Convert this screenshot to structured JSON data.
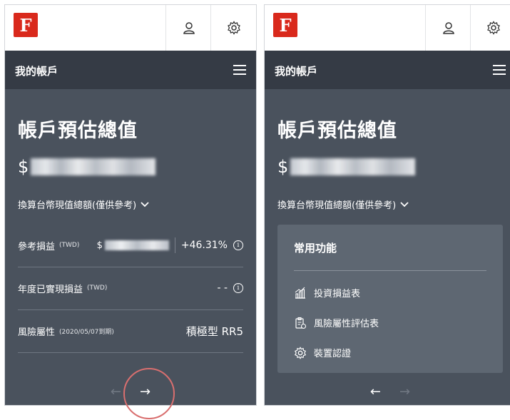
{
  "logo_letter": "F",
  "icons": [
    "user-icon",
    "gear-icon",
    "hamburger-icon",
    "info-icon",
    "chevron-down-icon",
    "chart-icon",
    "clipboard-icon"
  ],
  "colors": {
    "brand_red": "#d9291c",
    "panel": "#4a525d",
    "navbar": "#353b45",
    "card": "#5e6772",
    "highlight_circle": "#d96f6f"
  },
  "left": {
    "nav_title": "我的帳戶",
    "heading": "帳戶預估總值",
    "currency_symbol": "$",
    "convert_label": "換算台幣現值總額(僅供參考)",
    "rows": [
      {
        "label": "參考損益",
        "unit": "(TWD)",
        "currency_symbol": "$",
        "value": "+46.31%"
      },
      {
        "label": "年度已實現損益",
        "unit": "(TWD)",
        "value": "- -"
      },
      {
        "label": "風險屬性",
        "unit": "(2020/05/07到期)",
        "value": "積極型 RR5"
      }
    ],
    "prev_arrow": "←",
    "next_arrow": "→"
  },
  "right": {
    "nav_title": "我的帳戶",
    "heading": "帳戶預估總值",
    "currency_symbol": "$",
    "convert_label": "換算台幣現值總額(僅供參考)",
    "card_title": "常用功能",
    "card_items": [
      "投資損益表",
      "風險屬性評估表",
      "裝置認證"
    ],
    "prev_arrow": "←",
    "next_arrow": "→"
  }
}
